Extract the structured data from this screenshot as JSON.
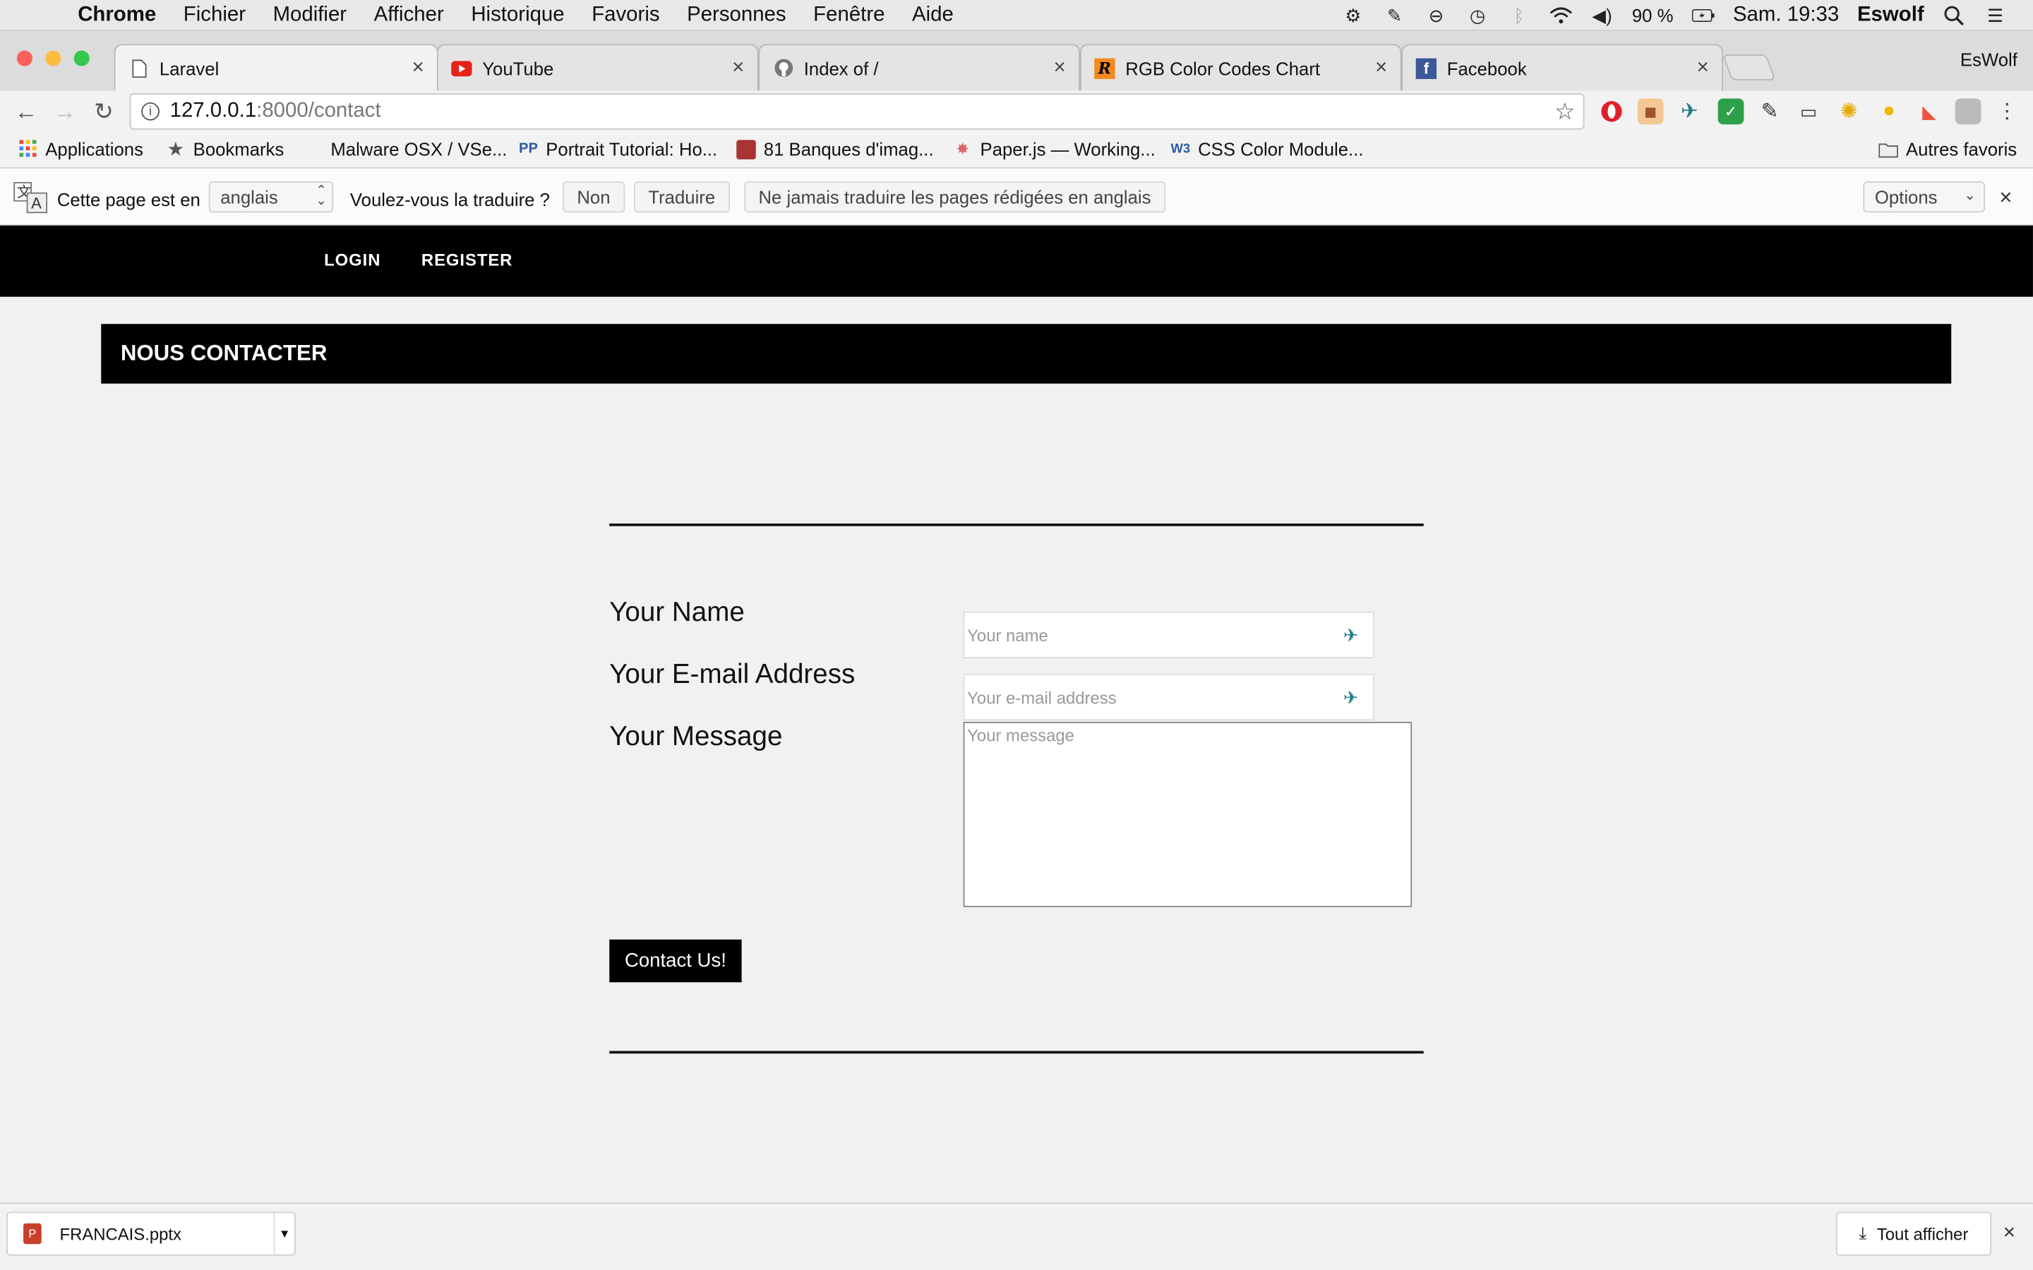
{
  "menubar": {
    "app": "Chrome",
    "menus": [
      "Fichier",
      "Modifier",
      "Afficher",
      "Historique",
      "Favoris",
      "Personnes",
      "Fenêtre",
      "Aide"
    ],
    "battery": "90 %",
    "clock": "Sam. 19:33",
    "user": "Eswolf"
  },
  "tabs": [
    {
      "title": "Laravel",
      "icon": "page-icon",
      "active": true
    },
    {
      "title": "YouTube",
      "icon": "youtube-icon",
      "active": false
    },
    {
      "title": "Index of /",
      "icon": "github-icon",
      "active": false
    },
    {
      "title": "RGB Color Codes Chart",
      "icon": "rapidtables-icon",
      "active": false
    },
    {
      "title": "Facebook",
      "icon": "facebook-icon",
      "active": false
    }
  ],
  "profile": "EsWolf",
  "omnibox": {
    "host": "127.0.0.1",
    "path": ":8000/contact"
  },
  "bookmarks": {
    "apps": "Applications",
    "items": [
      "Bookmarks",
      "Malware OSX / VSe...",
      "Portrait Tutorial: Ho...",
      "81 Banques d'imag...",
      "Paper.js — Working...",
      "CSS Color Module..."
    ],
    "other": "Autres favoris"
  },
  "translate": {
    "prefix": "Cette page est en",
    "language": "anglais",
    "question": "Voulez-vous la traduire ?",
    "no": "Non",
    "translate": "Traduire",
    "never": "Ne jamais traduire les pages rédigées en anglais",
    "options": "Options"
  },
  "page": {
    "nav": {
      "login": "LOGIN",
      "register": "REGISTER"
    },
    "title": "NOUS CONTACTER",
    "form": {
      "name_label": "Your Name",
      "name_placeholder": "Your name",
      "email_label": "Your E-mail Address",
      "email_placeholder": "Your e-mail address",
      "message_label": "Your Message",
      "message_placeholder": "Your message",
      "submit": "Contact Us!"
    }
  },
  "downloads": {
    "file": "FRANCAIS.pptx",
    "show_all": "Tout afficher"
  },
  "colors": {
    "nav_bg": "#000000",
    "page_bg": "#f1f1f1",
    "close_red": "#fc605c",
    "min_yellow": "#fdbc40",
    "max_green": "#34c84a"
  }
}
